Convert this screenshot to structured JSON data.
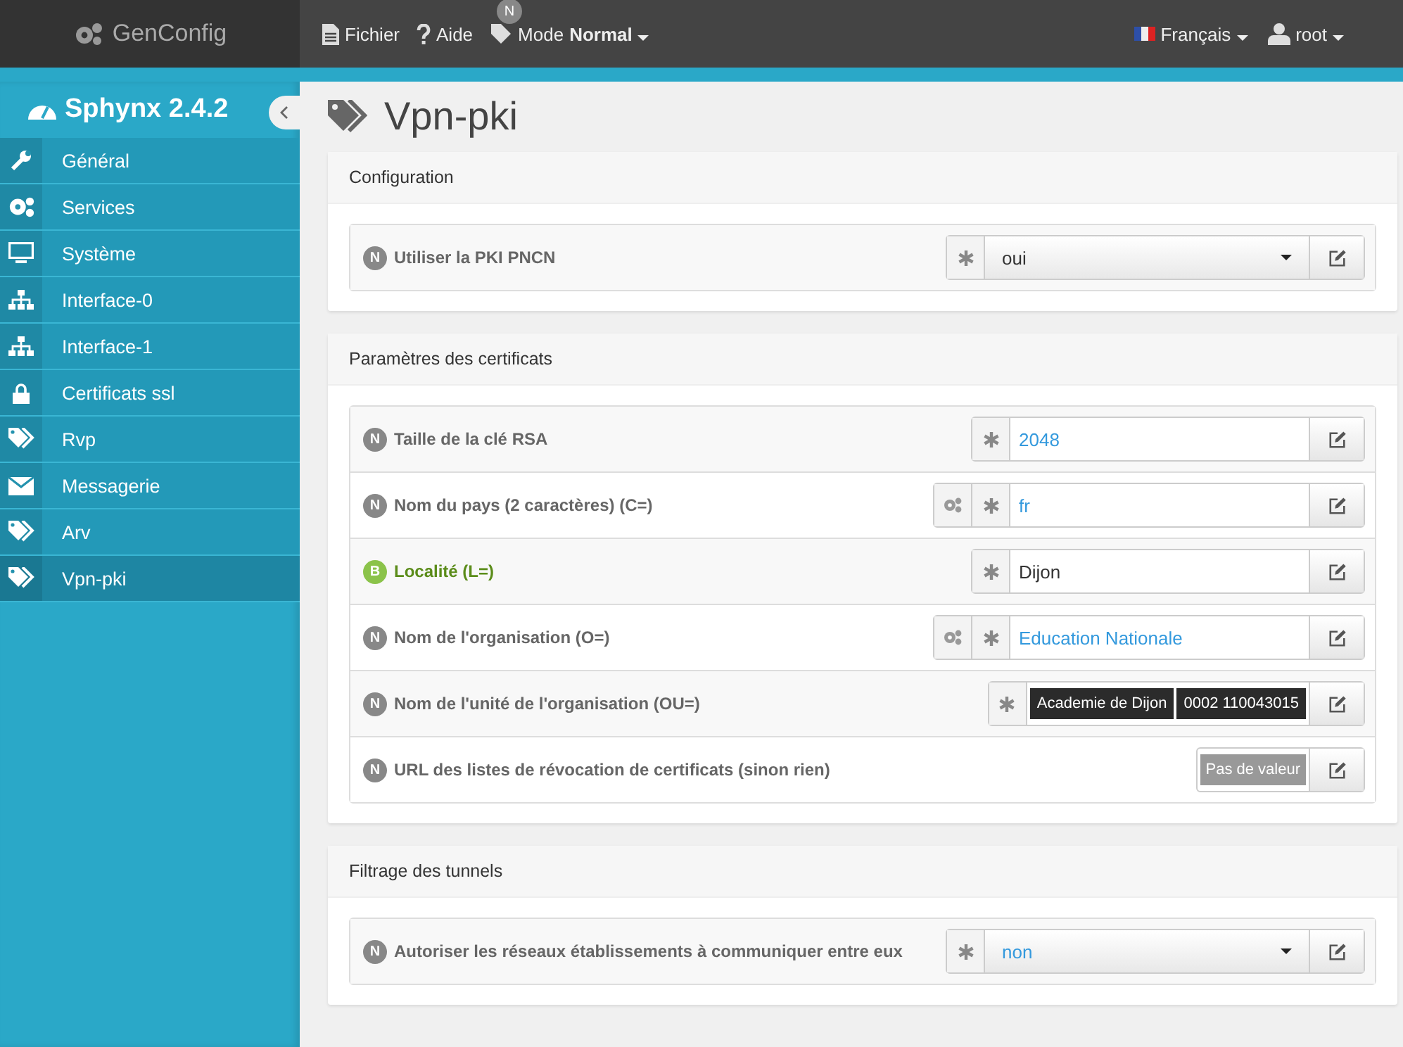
{
  "app": {
    "name": "GenConfig"
  },
  "menu": [
    {
      "label": "Fichier"
    },
    {
      "label": "Aide"
    }
  ],
  "mode": {
    "badge": "N",
    "label": "Mode",
    "value": "Normal"
  },
  "language": {
    "label": "Français"
  },
  "user": {
    "label": "root"
  },
  "sidebar": {
    "title": "Sphynx 2.4.2",
    "items": [
      {
        "label": "Général",
        "selected": false
      },
      {
        "label": "Services",
        "selected": false
      },
      {
        "label": "Système",
        "selected": false
      },
      {
        "label": "Interface-0",
        "selected": false
      },
      {
        "label": "Interface-1",
        "selected": false
      },
      {
        "label": "Certificats ssl",
        "selected": false
      },
      {
        "label": "Rvp",
        "selected": false
      },
      {
        "label": "Messagerie",
        "selected": false
      },
      {
        "label": "Arv",
        "selected": false
      },
      {
        "label": "Vpn-pki",
        "selected": true
      }
    ]
  },
  "page": {
    "title": "Vpn-pki"
  },
  "sections": [
    {
      "title": "Configuration",
      "rows": [
        {
          "badge": "N",
          "basic": false,
          "label": "Utiliser la PKI PNCN",
          "kind": "select",
          "auto": false,
          "required": true,
          "value": "oui",
          "default": false
        }
      ]
    },
    {
      "title": "Paramètres des certificats",
      "rows": [
        {
          "badge": "N",
          "basic": false,
          "label": "Taille de la clé RSA",
          "kind": "text",
          "auto": false,
          "required": true,
          "value": "2048",
          "default": true
        },
        {
          "badge": "N",
          "basic": false,
          "label": "Nom du pays (2 caractères) (C=)",
          "kind": "text",
          "auto": true,
          "required": true,
          "value": "fr",
          "default": true
        },
        {
          "badge": "B",
          "basic": true,
          "label": "Localité (L=)",
          "kind": "text",
          "auto": false,
          "required": true,
          "value": "Dijon",
          "default": false
        },
        {
          "badge": "N",
          "basic": false,
          "label": "Nom de l'organisation (O=)",
          "kind": "text",
          "auto": true,
          "required": true,
          "value": "Education Nationale",
          "default": true
        },
        {
          "badge": "N",
          "basic": false,
          "label": "Nom de l'unité de l'organisation (OU=)",
          "kind": "multi",
          "auto": false,
          "required": true,
          "values": [
            "Academie de Dijon",
            "0002 110043015"
          ]
        },
        {
          "badge": "N",
          "basic": false,
          "label": "URL des listes de révocation de certificats (sinon rien)",
          "kind": "empty",
          "auto": false,
          "required": false,
          "placeholder": "Pas de valeur"
        }
      ]
    },
    {
      "title": "Filtrage des tunnels",
      "rows": [
        {
          "badge": "N",
          "basic": false,
          "label": "Autoriser les réseaux établissements à communiquer entre eux",
          "kind": "select",
          "auto": false,
          "required": true,
          "value": "non",
          "default": true
        }
      ]
    }
  ]
}
